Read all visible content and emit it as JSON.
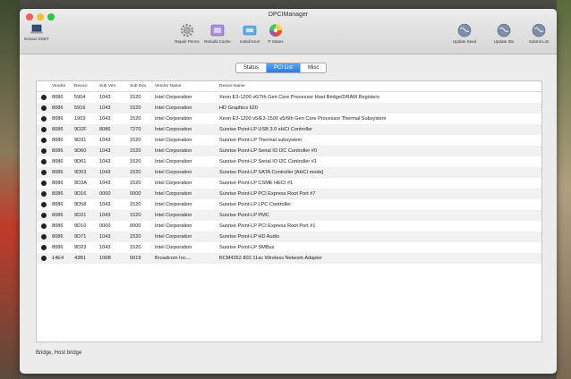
{
  "window": {
    "title": "DPCIManager"
  },
  "toolbar": {
    "extract_label": "Extract DSDT",
    "repair_label": "Repair Perms",
    "rebuild_label": "Rebuild Cache",
    "install_label": "Install Kext",
    "pstates_label": "P States",
    "update_seed_label": "Update Seed",
    "update_ids_label": "Update IDs",
    "submit_list_label": "Submit List"
  },
  "tabs": [
    {
      "label": "Status"
    },
    {
      "label": "PCI List"
    },
    {
      "label": "Misc"
    }
  ],
  "table": {
    "columns": [
      "Vendor",
      "Device",
      "Sub Ven",
      "Sub Dev",
      "Vendor Name",
      "Device Name"
    ],
    "rows": [
      [
        "8086",
        "5904",
        "1043",
        "1520",
        "Intel Corporation",
        "Xeon E3-1200 v6/7th Gen Core Processor Host Bridge/DRAM Registers"
      ],
      [
        "8086",
        "5916",
        "1043",
        "1520",
        "Intel Corporation",
        "HD Graphics 620"
      ],
      [
        "8086",
        "1903",
        "1043",
        "1520",
        "Intel Corporation",
        "Xeon E3-1200 v5/E3-1500 v5/6th Gen Core Processor Thermal Subsystem"
      ],
      [
        "8086",
        "9D2F",
        "8086",
        "7270",
        "Intel Corporation",
        "Sunrise Point-LP USB 3.0 xHCI Controller"
      ],
      [
        "8086",
        "9D31",
        "1043",
        "1520",
        "Intel Corporation",
        "Sunrise Point-LP Thermal subsystem"
      ],
      [
        "8086",
        "9D60",
        "1043",
        "1520",
        "Intel Corporation",
        "Sunrise Point-LP Serial IO I2C Controller #0"
      ],
      [
        "8086",
        "9D61",
        "1043",
        "1520",
        "Intel Corporation",
        "Sunrise Point-LP Serial IO I2C Controller #1"
      ],
      [
        "8086",
        "9D03",
        "1043",
        "1520",
        "Intel Corporation",
        "Sunrise Point-LP SATA Controller [AHCI mode]"
      ],
      [
        "8086",
        "9D3A",
        "1043",
        "1520",
        "Intel Corporation",
        "Sunrise Point-LP CSME HECI #1"
      ],
      [
        "8086",
        "9D16",
        "0000",
        "0000",
        "Intel Corporation",
        "Sunrise Point-LP PCI Express Root Port #7"
      ],
      [
        "8086",
        "9D58",
        "1043",
        "1520",
        "Intel Corporation",
        "Sunrise Point-LP LPC Controller"
      ],
      [
        "8086",
        "9D21",
        "1043",
        "1520",
        "Intel Corporation",
        "Sunrise Point-LP PMC"
      ],
      [
        "8086",
        "9D10",
        "0000",
        "0000",
        "Intel Corporation",
        "Sunrise Point-LP PCI Express Root Port #1"
      ],
      [
        "8086",
        "9D71",
        "1043",
        "1520",
        "Intel Corporation",
        "Sunrise Point-LP HD Audio"
      ],
      [
        "8086",
        "9D23",
        "1043",
        "1520",
        "Intel Corporation",
        "Sunrise Point-LP SMBus"
      ],
      [
        "14E4",
        "43B1",
        "106B",
        "0019",
        "Broadcom Inc....",
        "BCM4352 802.11ac Wireless Network Adapter"
      ]
    ]
  },
  "status_text": "Bridge, Host bridge",
  "icons": {
    "extract": "laptop-icon",
    "repair": "gear-icon",
    "rebuild": "cache-icon",
    "install": "kext-icon",
    "pstates": "color-wheel-icon",
    "seed": "globe-icon"
  },
  "colors": {
    "accent": "#2a7ae6",
    "row_alt": "#f1f1f1"
  }
}
